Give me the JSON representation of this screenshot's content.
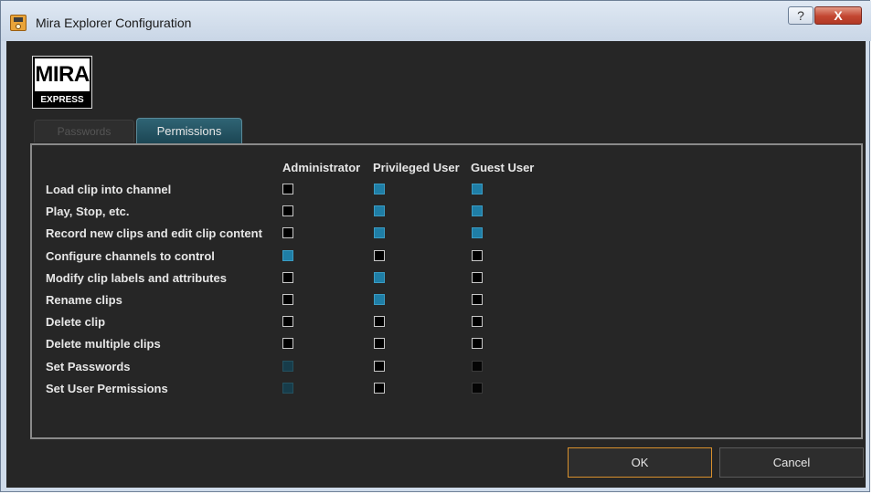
{
  "window": {
    "title": "Mira Explorer Configuration",
    "help_label": "?",
    "close_label": "X",
    "app_icon": "mira-app-icon"
  },
  "logo": {
    "top": "MIRA",
    "bottom": "EXPRESS"
  },
  "tabs": [
    {
      "label": "Passwords",
      "active": false
    },
    {
      "label": "Permissions",
      "active": true
    }
  ],
  "permissions": {
    "columns": [
      "Administrator",
      "Privileged User",
      "Guest User"
    ],
    "rows": [
      {
        "label": "Load clip into channel",
        "values": [
          "off",
          "on",
          "on"
        ]
      },
      {
        "label": "Play, Stop, etc.",
        "values": [
          "off",
          "on",
          "on"
        ]
      },
      {
        "label": "Record new clips and edit clip content",
        "values": [
          "off",
          "on",
          "on"
        ]
      },
      {
        "label": "Configure channels to control",
        "values": [
          "on",
          "off",
          "off"
        ]
      },
      {
        "label": "Modify clip labels and attributes",
        "values": [
          "off",
          "on",
          "off"
        ]
      },
      {
        "label": "Rename clips",
        "values": [
          "off",
          "on",
          "off"
        ]
      },
      {
        "label": "Delete clip",
        "values": [
          "off",
          "off",
          "off"
        ]
      },
      {
        "label": "Delete multiple clips",
        "values": [
          "off",
          "off",
          "off"
        ]
      },
      {
        "label": "Set Passwords",
        "values": [
          "dis-on",
          "off",
          "dis-off"
        ]
      },
      {
        "label": "Set User Permissions",
        "values": [
          "dis-on",
          "off",
          "dis-off"
        ]
      }
    ]
  },
  "buttons": {
    "ok": "OK",
    "cancel": "Cancel"
  },
  "colors": {
    "checked": "#1f7ea6",
    "accent_focus": "#d8902d",
    "background": "#262626"
  }
}
